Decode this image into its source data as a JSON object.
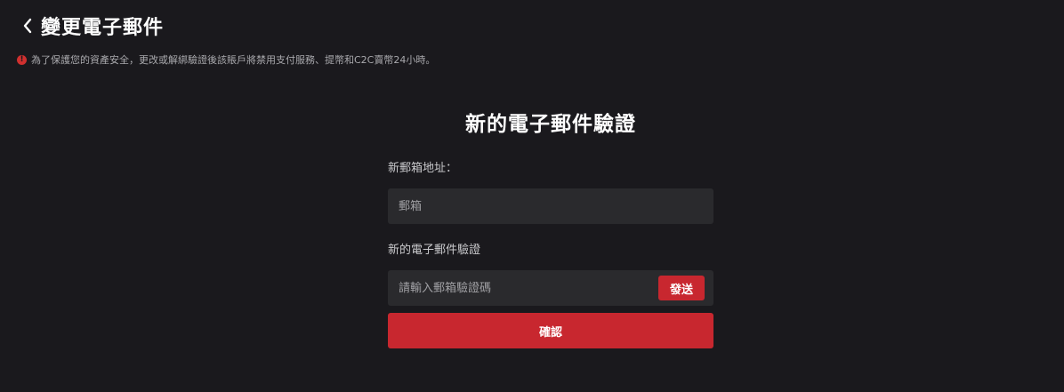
{
  "header": {
    "title": "變更電子郵件",
    "back_icon": "chevron-left-icon"
  },
  "warning": {
    "icon": "exclamation-circle-icon",
    "text": "為了保護您的資產安全，更改或解綁驗證後該賬戶將禁用支付服務、提幣和C2C賣幣24小時。",
    "icon_color": "#d0302f"
  },
  "form": {
    "title": "新的電子郵件驗證",
    "email_label": "新郵箱地址：",
    "email_placeholder": "郵箱",
    "code_label": "新的電子郵件驗證",
    "code_placeholder": "請輸入郵箱驗證碼",
    "send_label": "發送",
    "confirm_label": "確認"
  },
  "colors": {
    "background": "#1a191d",
    "input_bg": "#2a2a2d",
    "accent": "#c8272f"
  }
}
